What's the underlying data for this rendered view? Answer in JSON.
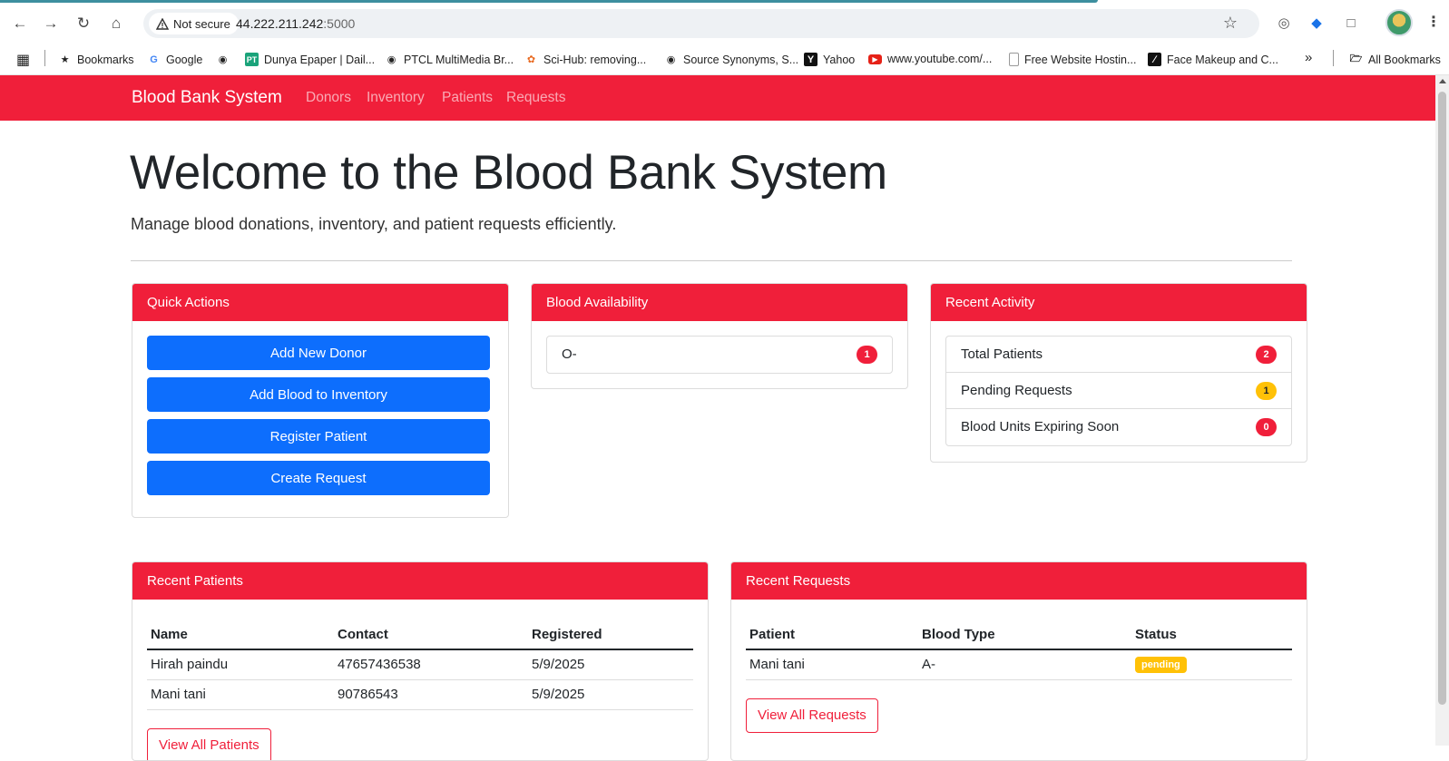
{
  "browser": {
    "security_label": "Not secure",
    "url_host": "44.222.211.242",
    "url_port": ":5000",
    "bookmarks": [
      {
        "label": "Bookmarks",
        "icon": "star-icon"
      },
      {
        "label": "Google",
        "icon": "google-icon"
      },
      {
        "label": "",
        "icon": "globe-icon"
      },
      {
        "label": "Dunya Epaper | Dail...",
        "icon": "pt-icon"
      },
      {
        "label": "PTCL MultiMedia Br...",
        "icon": "globe-icon"
      },
      {
        "label": "Sci-Hub: removing...",
        "icon": "scihub-icon"
      },
      {
        "label": "Source Synonyms, S...",
        "icon": "globe-icon"
      },
      {
        "label": "Yahoo",
        "icon": "yahoo-icon"
      },
      {
        "label": "www.youtube.com/...",
        "icon": "youtube-icon"
      },
      {
        "label": "Free Website Hostin...",
        "icon": "doc-icon"
      },
      {
        "label": "Face Makeup and C...",
        "icon": "face-icon"
      }
    ],
    "all_bookmarks": "All Bookmarks",
    "overflow": "»"
  },
  "navbar": {
    "brand": "Blood Bank System",
    "links": [
      "Donors",
      "Inventory",
      "Patients",
      "Requests"
    ]
  },
  "hero": {
    "title": "Welcome to the Blood Bank System",
    "subtitle": "Manage blood donations, inventory, and patient requests efficiently."
  },
  "quick_actions": {
    "title": "Quick Actions",
    "buttons": [
      "Add New Donor",
      "Add Blood to Inventory",
      "Register Patient",
      "Create Request"
    ]
  },
  "blood_availability": {
    "title": "Blood Availability",
    "items": [
      {
        "type": "O-",
        "count": "1"
      }
    ]
  },
  "recent_activity": {
    "title": "Recent Activity",
    "items": [
      {
        "label": "Total Patients",
        "count": "2"
      },
      {
        "label": "Pending Requests",
        "count": "1"
      },
      {
        "label": "Blood Units Expiring Soon",
        "count": "0"
      }
    ]
  },
  "recent_patients": {
    "title": "Recent Patients",
    "columns": [
      "Name",
      "Contact",
      "Registered"
    ],
    "rows": [
      [
        "Hirah paindu",
        "47657436538",
        "5/9/2025"
      ],
      [
        "Mani tani",
        "90786543",
        "5/9/2025"
      ]
    ],
    "button": "View All Patients"
  },
  "recent_requests": {
    "title": "Recent Requests",
    "columns": [
      "Patient",
      "Blood Type",
      "Status"
    ],
    "rows": [
      [
        "Mani tani",
        "A-",
        "pending"
      ]
    ],
    "button": "View All Requests"
  },
  "colors": {
    "brand_red": "#f01f3a",
    "primary_blue": "#0d6efd",
    "warning_yellow": "#ffc107"
  }
}
